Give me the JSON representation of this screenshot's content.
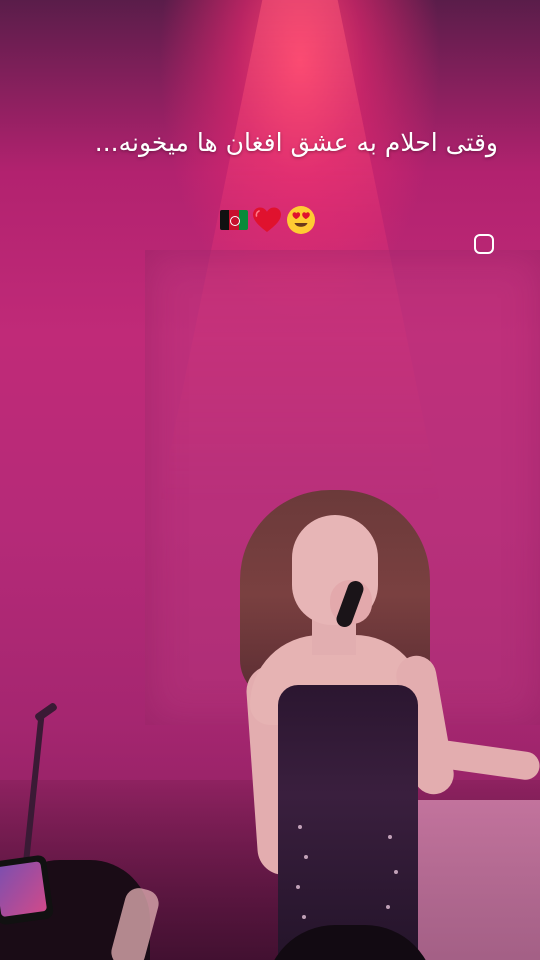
{
  "overlay": {
    "caption": "وقتی احلام به عشق افغان ها میخونه...",
    "emojis": [
      "afghanistan-flag",
      "red-heart",
      "heart-eyes-face"
    ]
  },
  "controls": {
    "record_icon": "rounded-square-outline"
  },
  "colors": {
    "stage_background": "#b52a78",
    "spotlight": "#ff4670",
    "caption_text": "#ffffff"
  }
}
